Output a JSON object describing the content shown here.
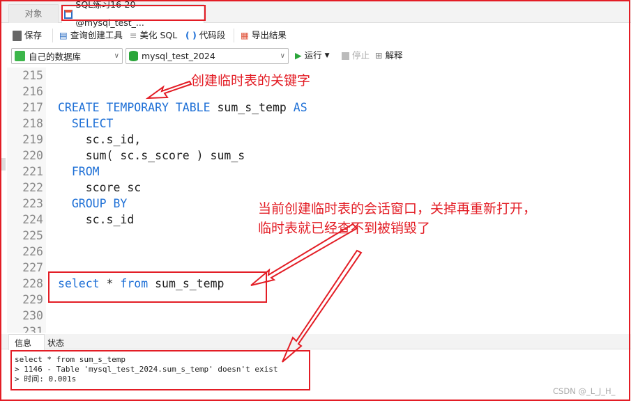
{
  "tabs": {
    "objects": "对象",
    "query": "SQL练习16-20 @mysql_test_..."
  },
  "toolbar": {
    "save": "保存",
    "query_builder": "查询创建工具",
    "beautify": "美化 SQL",
    "snippet": "代码段",
    "export": "导出结果",
    "run": "运行",
    "stop": "停止",
    "explain": "解释"
  },
  "connection": {
    "value": "自己的数据库"
  },
  "database": {
    "value": "mysql_test_2024"
  },
  "editor": {
    "lines": [
      {
        "n": "215",
        "code": []
      },
      {
        "n": "216",
        "code": []
      },
      {
        "n": "217",
        "code": [
          {
            "t": "CREATE TEMPORARY TABLE",
            "k": 1
          },
          {
            "t": " sum_s_temp "
          },
          {
            "t": "AS",
            "k": 1
          }
        ]
      },
      {
        "n": "218",
        "code": [
          {
            "t": "  "
          },
          {
            "t": "SELECT",
            "k": 1
          }
        ]
      },
      {
        "n": "219",
        "code": [
          {
            "t": "    sc.s_id,"
          }
        ]
      },
      {
        "n": "220",
        "code": [
          {
            "t": "    sum( sc.s_score ) sum_s"
          }
        ]
      },
      {
        "n": "221",
        "code": [
          {
            "t": "  "
          },
          {
            "t": "FROM",
            "k": 1
          }
        ]
      },
      {
        "n": "222",
        "code": [
          {
            "t": "    score sc"
          }
        ]
      },
      {
        "n": "223",
        "code": [
          {
            "t": "  "
          },
          {
            "t": "GROUP BY",
            "k": 1
          }
        ]
      },
      {
        "n": "224",
        "code": [
          {
            "t": "    sc.s_id"
          }
        ]
      },
      {
        "n": "225",
        "code": []
      },
      {
        "n": "226",
        "code": []
      },
      {
        "n": "227",
        "code": []
      },
      {
        "n": "228",
        "code": [
          {
            "t": "select",
            "k": 1
          },
          {
            "t": " * "
          },
          {
            "t": "from",
            "k": 1
          },
          {
            "t": " sum_s_temp"
          }
        ]
      },
      {
        "n": "229",
        "code": []
      },
      {
        "n": "230",
        "code": []
      },
      {
        "n": "231",
        "code": []
      }
    ]
  },
  "output": {
    "tabs": [
      "信息",
      "状态"
    ],
    "lines": [
      "select * from sum_s_temp",
      "> 1146 - Table 'mysql_test_2024.sum_s_temp' doesn't exist",
      "> 时间: 0.001s"
    ]
  },
  "annotations": {
    "keyword_note": "创建临时表的关键字",
    "session_note_1": "当前创建临时表的会话窗口，关掉再重新打开，",
    "session_note_2": "临时表就已经查不到被销毁了"
  },
  "watermark": "CSDN @_L_J_H_",
  "colors": {
    "keyword": "#1d6fd6",
    "annotation": "#e31d25"
  }
}
